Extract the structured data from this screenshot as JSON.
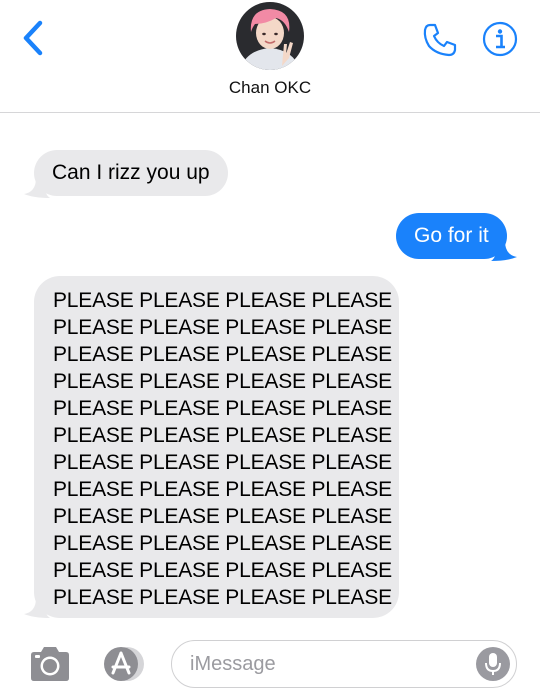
{
  "header": {
    "contact_name": "Chan OKC",
    "back_icon": "chevron-left-icon",
    "call_icon": "phone-icon",
    "info_icon": "info-icon"
  },
  "messages": [
    {
      "direction": "incoming",
      "text": "Can I rizz you up"
    },
    {
      "direction": "outgoing",
      "text": "Go for it"
    },
    {
      "direction": "incoming",
      "lines": [
        "PLEASE PLEASE PLEASE PLEASE",
        "PLEASE PLEASE PLEASE PLEASE",
        "PLEASE PLEASE PLEASE PLEASE",
        "PLEASE PLEASE PLEASE PLEASE",
        "PLEASE PLEASE PLEASE PLEASE",
        "PLEASE PLEASE PLEASE PLEASE",
        "PLEASE PLEASE PLEASE PLEASE",
        "PLEASE PLEASE PLEASE PLEASE",
        "PLEASE PLEASE PLEASE PLEASE",
        "PLEASE PLEASE PLEASE PLEASE",
        "PLEASE PLEASE PLEASE PLEASE",
        "PLEASE PLEASE PLEASE PLEASE"
      ]
    }
  ],
  "composer": {
    "placeholder": "iMessage",
    "camera_icon": "camera-icon",
    "apps_icon": "app-store-icon",
    "mic_icon": "microphone-icon"
  },
  "colors": {
    "accent": "#1a82fb",
    "incoming_bubble": "#e9e9eb",
    "outgoing_bubble": "#1a82fb"
  }
}
